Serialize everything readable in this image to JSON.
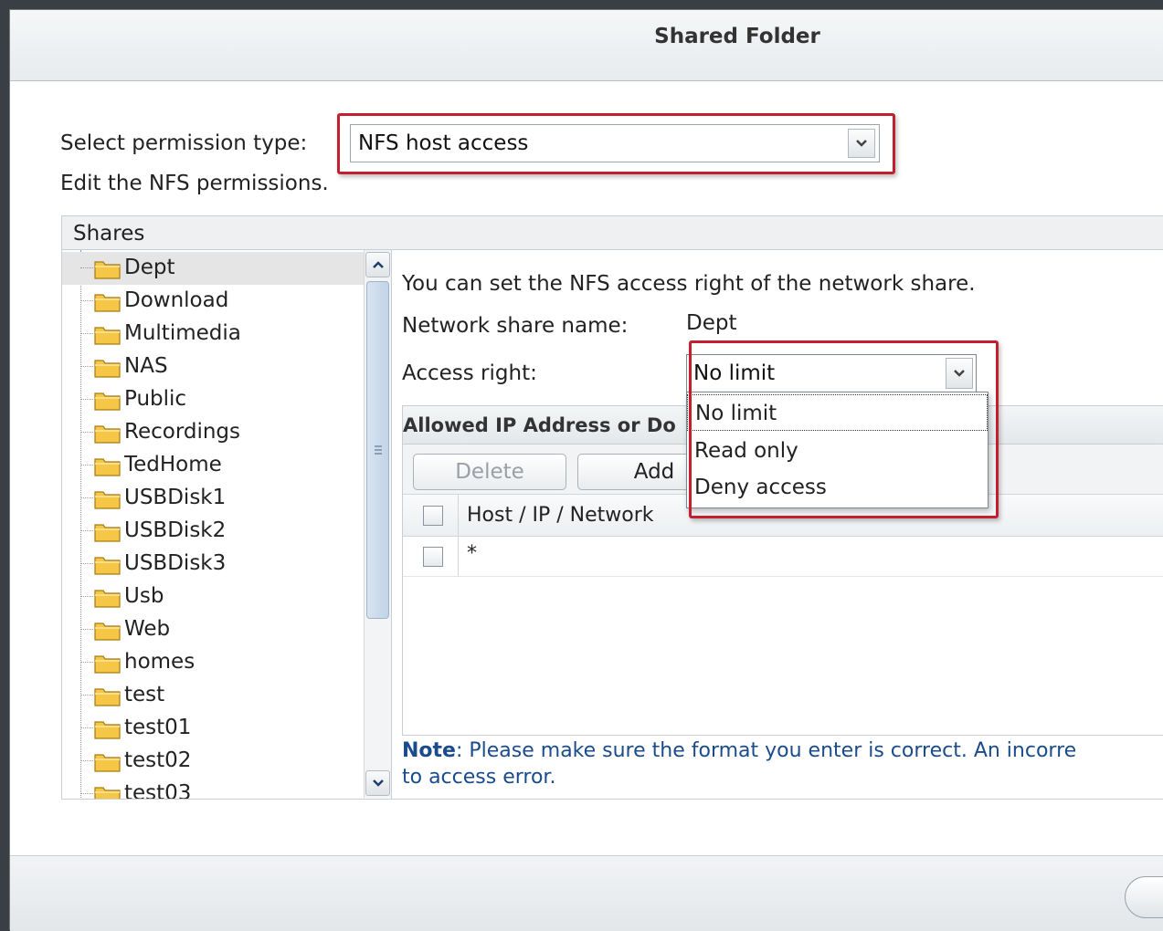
{
  "dialog": {
    "title": "Shared Folder"
  },
  "permission": {
    "label": "Select permission type:",
    "value": "NFS host access",
    "edit_note": "Edit the NFS permissions."
  },
  "shares": {
    "header": "Shares",
    "items": [
      "Dept",
      "Download",
      "Multimedia",
      "NAS",
      "Public",
      "Recordings",
      "TedHome",
      "USBDisk1",
      "USBDisk2",
      "USBDisk3",
      "Usb",
      "Web",
      "homes",
      "test",
      "test01",
      "test02",
      "test03"
    ],
    "selected": "Dept"
  },
  "nfs": {
    "intro": "You can set the NFS access right of the network share.",
    "share_name_label": "Network share name:",
    "share_name_value": "Dept",
    "access_label": "Access right:",
    "access_value": "No limit",
    "access_options": [
      "No limit",
      "Read only",
      "Deny access"
    ]
  },
  "ip_grid": {
    "title": "Allowed IP Address or Do",
    "delete_label": "Delete",
    "add_label": "Add",
    "column": "Host / IP / Network",
    "rows": [
      "*"
    ]
  },
  "note": {
    "prefix": "Note",
    "line1": ": Please make sure the format you enter is correct. An incorre",
    "line2": "to access error."
  },
  "colors": {
    "highlight": "#c2202e",
    "note_text": "#1a4c8c"
  }
}
